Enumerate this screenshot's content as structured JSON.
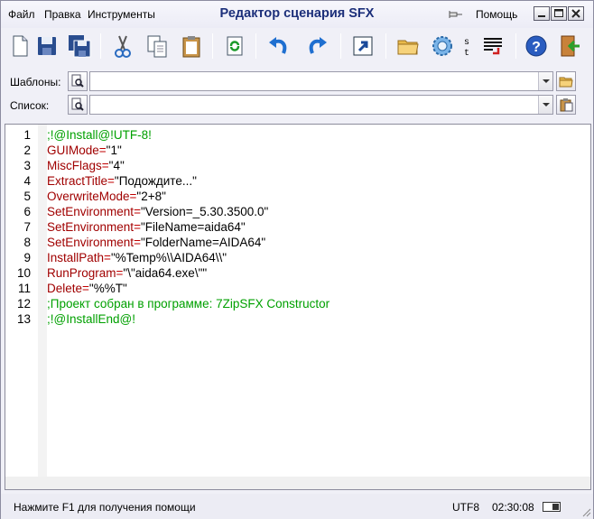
{
  "menu": {
    "file": "Файл",
    "edit": "Правка",
    "tools": "Инструменты",
    "help": "Помощь"
  },
  "window": {
    "title": "Редактор сценария SFX"
  },
  "toolbar": {
    "items": [
      "new-file-icon",
      "save-icon",
      "save-all-icon",
      "cut-icon",
      "copy-icon",
      "paste-icon",
      "refresh-icon",
      "undo-icon",
      "redo-icon",
      "goto-icon",
      "open-folder-icon",
      "settings-gear-icon",
      "string-icon",
      "format-icon",
      "help-icon",
      "exit-door-icon"
    ],
    "string_glyph_top": "s",
    "string_glyph_bottom": "t"
  },
  "templates": {
    "label": "Шаблоны:",
    "value": ""
  },
  "list": {
    "label": "Список:",
    "value": ""
  },
  "editor": {
    "line_numbers": [
      "1",
      "2",
      "3",
      "4",
      "5",
      "6",
      "7",
      "8",
      "9",
      "10",
      "11",
      "12",
      "13"
    ],
    "lines": [
      {
        "key": "",
        "eq": "",
        "val": "",
        "comment": ";!@Install@!UTF-8!"
      },
      {
        "key": "GUIMode",
        "eq": "=",
        "val": "\"1\"",
        "comment": ""
      },
      {
        "key": "MiscFlags",
        "eq": "=",
        "val": "\"4\"",
        "comment": ""
      },
      {
        "key": "ExtractTitle",
        "eq": "=",
        "val": "\"Подождите...\"",
        "comment": ""
      },
      {
        "key": "OverwriteMode",
        "eq": "=",
        "val": "\"2+8\"",
        "comment": ""
      },
      {
        "key": "SetEnvironment",
        "eq": "=",
        "val": "\"Version=_5.30.3500.0\"",
        "comment": ""
      },
      {
        "key": "SetEnvironment",
        "eq": "=",
        "val": "\"FileName=aida64\"",
        "comment": ""
      },
      {
        "key": "SetEnvironment",
        "eq": "=",
        "val": "\"FolderName=AIDA64\"",
        "comment": ""
      },
      {
        "key": "InstallPath",
        "eq": "=",
        "val": "\"%Temp%\\\\AIDA64\\\\\"",
        "comment": ""
      },
      {
        "key": "RunProgram",
        "eq": "=",
        "val": "\"\\\"aida64.exe\\\"\"",
        "comment": ""
      },
      {
        "key": "Delete",
        "eq": "=",
        "val": "\"%%T\"",
        "comment": ""
      },
      {
        "key": "",
        "eq": "",
        "val": "",
        "comment": ";Проект собран в программе: 7ZipSFX Constructor"
      },
      {
        "key": "",
        "eq": "",
        "val": "",
        "comment": ";!@InstallEnd@!"
      }
    ]
  },
  "status": {
    "hint": "Нажмите F1 для получения помощи",
    "encoding": "UTF8",
    "time": "02:30:08"
  },
  "colors": {
    "key": "#a00000",
    "comment": "#00a000",
    "title": "#1c2f7a"
  }
}
